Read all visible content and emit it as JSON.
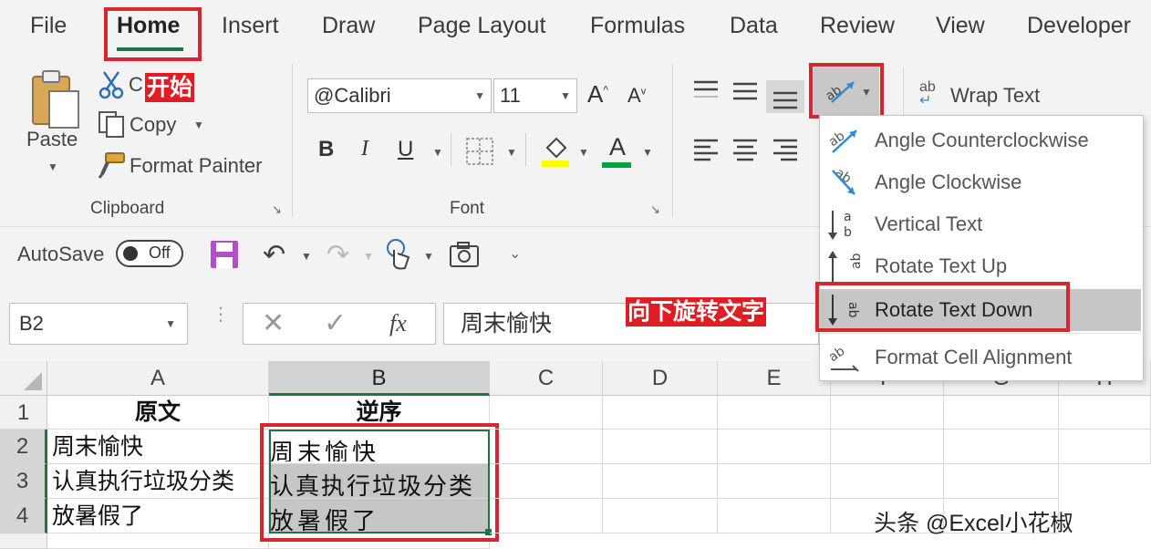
{
  "tabs": [
    "File",
    "Home",
    "Insert",
    "Draw",
    "Page Layout",
    "Formulas",
    "Data",
    "Review",
    "View",
    "Developer"
  ],
  "clipboard": {
    "paste": "Paste",
    "cut": "C",
    "copy": "Copy",
    "format_painter": "Format Painter",
    "group": "Clipboard",
    "annotation": "开始"
  },
  "font": {
    "name": "@Calibri",
    "size": "11",
    "grow": "A",
    "shrink": "A",
    "bold": "B",
    "italic": "I",
    "underline": "U",
    "font_color": "A",
    "group": "Font"
  },
  "alignment": {
    "wrap_text": "Wrap Text",
    "wrap_icon_text": "ab"
  },
  "orientation_menu": [
    {
      "icon": "angle-counterclockwise-icon",
      "label": "Angle Counterclockwise",
      "enabled": false
    },
    {
      "icon": "angle-clockwise-icon",
      "label": "Angle Clockwise",
      "enabled": false
    },
    {
      "icon": "vertical-text-icon",
      "label": "Vertical Text",
      "enabled": false
    },
    {
      "icon": "rotate-text-up-icon",
      "label": "Rotate Text Up",
      "enabled": false
    },
    {
      "icon": "rotate-text-down-icon",
      "label": "Rotate Text Down",
      "enabled": true,
      "highlighted": true
    },
    {
      "icon": "format-cell-alignment-icon",
      "label": "Format Cell Alignment",
      "enabled": false
    }
  ],
  "menu_annotation": "向下旋转文字",
  "qat": {
    "autosave": "AutoSave",
    "toggle": "Off"
  },
  "formula_bar": {
    "name_box": "B2",
    "fx": "fx",
    "content": "周末愉快"
  },
  "grid": {
    "columns": [
      "A",
      "B",
      "C",
      "D",
      "E",
      "F",
      "G",
      "H"
    ],
    "rows": [
      "1",
      "2",
      "3",
      "4"
    ],
    "a": [
      "原文",
      "周末愉快",
      "认真执行垃圾分类",
      "放暑假了"
    ],
    "b_header": "逆序",
    "b": [
      "周末愉快",
      "认真执行垃圾分类",
      "放暑假了"
    ]
  },
  "watermark": "头条 @Excel小花椒",
  "colors": {
    "accent_green": "#217346",
    "annotation_red": "#d9262e",
    "selection_gray": "#c6c6c6"
  }
}
